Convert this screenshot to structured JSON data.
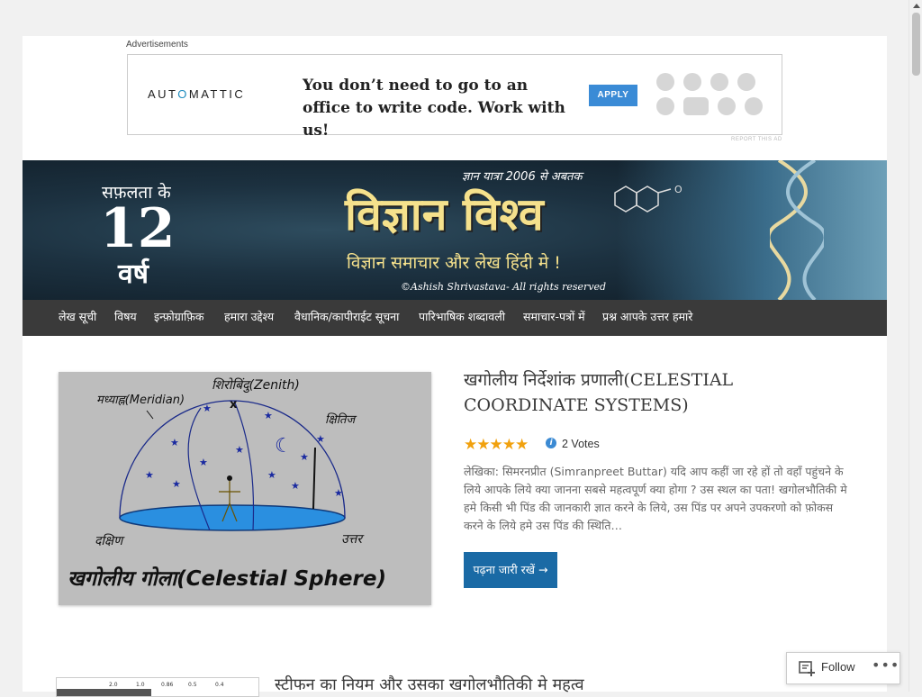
{
  "ads": {
    "label": "Advertisements",
    "brand": "AUTOMATTIC",
    "headline": "You don’t need to go to an office to write code. Work with us!",
    "apply_label": "APPLY",
    "report_label": "REPORT THIS AD",
    "icons": [
      "wordpress-icon",
      "jetpack-icon",
      "akismet-icon",
      "power-icon",
      "longreads-icon",
      "woo-icon",
      "simplenote-icon",
      "crowdsignal-icon"
    ]
  },
  "banner": {
    "prefix": "सफ़लता के",
    "years_number": "12",
    "years_suffix": "वर्ष",
    "tagline": "ज्ञान यात्रा 2006 से अबतक",
    "site_title": "विज्ञान विश्व",
    "subtitle": "विज्ञान समाचार और लेख हिंदी मे !",
    "copyright": "©Ashish Shrivastava- All rights reserved"
  },
  "nav": {
    "items": [
      "लेख सूची",
      "विषय",
      "इन्फ़ोग्राफ़िक",
      "हमारा उद्देश्य",
      "वैधानिक/कापीराईट सूचना",
      "पारिभाषिक शब्दावली",
      "समाचार-पत्रों में",
      "प्रश्न आपके उत्तर हमारे"
    ]
  },
  "post1": {
    "title": "खगोलीय निर्देशांक प्रणाली(CELESTIAL COORDINATE SYSTEMS)",
    "rating": 5,
    "rating_max": 5,
    "rating_info": "i",
    "votes": "2 Votes",
    "excerpt": "लेखिका:  सिमरनप्रीत (Simranpreet Buttar) यदि आप कहीं जा रहे हों तो वहाँ पहुंचने के लिये आपके लिये क्या जानना सबसे महत्वपूर्ण क्या होगा ? उस स्थल का पता! खगोलभौतिकी मे हमे किसी भी पिंड की जानकारी ज्ञात करने के लिये, उस पिंड पर अपने उपकरणो को फ़ोकस करने के लिये हमे उस पिंड की स्थिति…",
    "read_more": "पढ़ना जारी रखें →",
    "image": {
      "zenith": "शिरोबिंदु(Zenith)",
      "meridian": "मध्याह्न(Meridian)",
      "horizon": "क्षितिज",
      "south": "दक्षिण",
      "north": "उत्तर",
      "caption": "खगोलीय गोला(Celestial Sphere)"
    }
  },
  "post2": {
    "title": "स्टीफन का नियम और उसका खगोलभौतिकी मे महत्व",
    "thumb_ticks": [
      "2.0",
      "1.0",
      "0.86",
      "0.5",
      "0.4"
    ]
  },
  "follow": {
    "label": "Follow",
    "more": "•••"
  }
}
